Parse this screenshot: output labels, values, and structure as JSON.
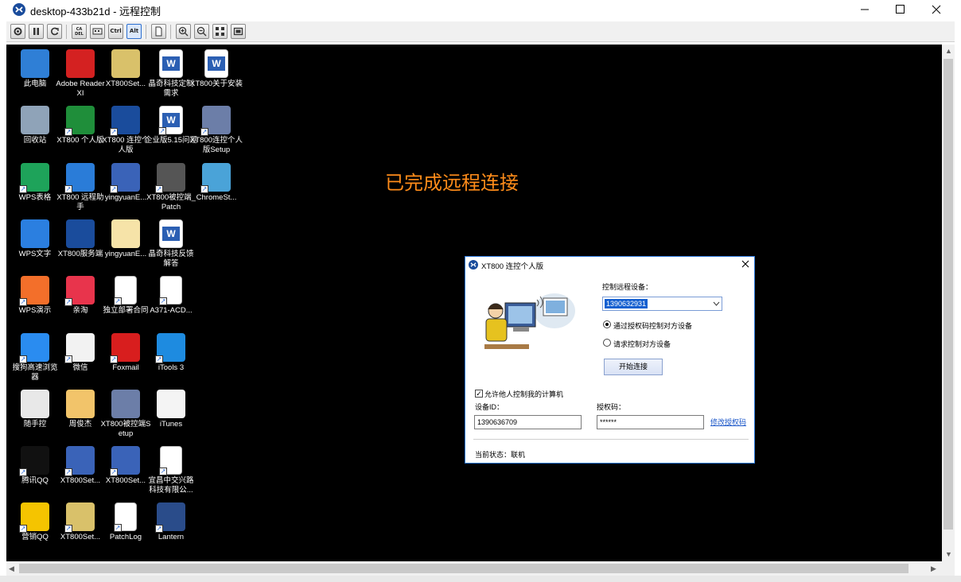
{
  "window": {
    "title": "desktop-433b21d - 远程控制",
    "app_icon": "xt800-icon",
    "controls": [
      "minimize-icon",
      "maximize-icon",
      "close-icon"
    ]
  },
  "toolbar": {
    "buttons": [
      {
        "name": "settings-icon"
      },
      {
        "name": "pause-icon"
      },
      {
        "name": "refresh-icon"
      },
      {
        "name": "ctrl-alt-del-icon",
        "text": "CA DEL"
      },
      {
        "name": "keyboard-icon"
      },
      {
        "name": "ctrl-key-icon",
        "text": "Ctrl"
      },
      {
        "name": "alt-key-icon",
        "text": "Alt"
      },
      {
        "name": "file-icon"
      },
      {
        "name": "zoom-in-icon"
      },
      {
        "name": "zoom-out-icon"
      },
      {
        "name": "fit-screen-icon"
      },
      {
        "name": "fullscreen-icon"
      }
    ]
  },
  "desktop": {
    "banner": "已完成远程连接",
    "icons": [
      {
        "label": "此电脑",
        "icon": "computer-icon",
        "color": "#2f7fd6"
      },
      {
        "label": "回收站",
        "icon": "recycle-bin-icon",
        "color": "#8fa3b8"
      },
      {
        "label": "WPS表格",
        "icon": "wps-sheet-icon",
        "color": "#1ea35a"
      },
      {
        "label": "WPS文字",
        "icon": "wps-writer-icon",
        "color": "#2b7fe0"
      },
      {
        "label": "WPS演示",
        "icon": "wps-present-icon",
        "color": "#f36f2a"
      },
      {
        "label": "搜狗高速浏览器",
        "icon": "sogou-browser-icon",
        "color": "#2a8cf0"
      },
      {
        "label": "随手控",
        "icon": "suishoukong-icon",
        "color": "#e8e8e8"
      },
      {
        "label": "腾讯QQ",
        "icon": "qq-icon",
        "color": "#111111"
      },
      {
        "label": "营销QQ",
        "icon": "marketing-qq-icon",
        "color": "#f5c400"
      },
      {
        "label": "Adobe Reader XI",
        "icon": "adobe-reader-icon",
        "color": "#d42121"
      },
      {
        "label": "XT800 个人版",
        "icon": "xt800-personal-icon",
        "color": "#1f8e3a"
      },
      {
        "label": "XT800 远程助手",
        "icon": "xt800-assistant-icon",
        "color": "#2a7cd8"
      },
      {
        "label": "XT800服务端",
        "icon": "xt800-server-icon",
        "color": "#1a4c9c"
      },
      {
        "label": "亲淘",
        "icon": "qintao-icon",
        "color": "#e8344c"
      },
      {
        "label": "微信",
        "icon": "wechat-icon",
        "color": "#f2f2f2"
      },
      {
        "label": "周俊杰",
        "icon": "folder-icon",
        "color": "#f2c46a"
      },
      {
        "label": "XT800Set...",
        "icon": "winrar-icon",
        "color": "#3a63b8"
      },
      {
        "label": "XT800Set...",
        "icon": "setup-icon",
        "color": "#d9c16a"
      },
      {
        "label": "XT800Set...",
        "icon": "setup-icon",
        "color": "#d9c16a"
      },
      {
        "label": "XT800 连控个人版",
        "icon": "xt800-control-icon",
        "color": "#1a4c9c"
      },
      {
        "label": "yingyuanE...",
        "icon": "winrar-icon",
        "color": "#3a63b8"
      },
      {
        "label": "yingyuanE...",
        "icon": "folder-icon",
        "color": "#f6e3a8"
      },
      {
        "label": "独立部署合同",
        "icon": "pdf-icon",
        "color": "#ffffff"
      },
      {
        "label": "Foxmail",
        "icon": "foxmail-icon",
        "color": "#d81e1e"
      },
      {
        "label": "XT800被控端Setup",
        "icon": "installer-icon",
        "color": "#6c7ea8"
      },
      {
        "label": "XT800Set...",
        "icon": "winrar-icon",
        "color": "#3a63b8"
      },
      {
        "label": "PatchLog",
        "icon": "text-file-icon",
        "color": "#ffffff"
      },
      {
        "label": "晶奇科技定制需求",
        "icon": "word-doc-icon",
        "color": "#2b5fb3"
      },
      {
        "label": "企业版5.15问题",
        "icon": "word-doc-icon",
        "color": "#2b5fb3"
      },
      {
        "label": "XT800被控端_Patch",
        "icon": "patch-icon",
        "color": "#555555"
      },
      {
        "label": "晶奇科技反馈解答",
        "icon": "word-doc-icon",
        "color": "#2b5fb3"
      },
      {
        "label": "A371-ACD...",
        "icon": "blank-file-icon",
        "color": "#ffffff"
      },
      {
        "label": "iTools 3",
        "icon": "itools-icon",
        "color": "#1e8be0"
      },
      {
        "label": "iTunes",
        "icon": "itunes-icon",
        "color": "#f4f4f4"
      },
      {
        "label": "宜昌中交兴路科技有限公...",
        "icon": "pdf-icon",
        "color": "#ffffff"
      },
      {
        "label": "Lantern",
        "icon": "lantern-icon",
        "color": "#2a4c8a"
      },
      {
        "label": "XT800关于安装",
        "icon": "word-doc-icon",
        "color": "#2b5fb3"
      },
      {
        "label": "XT800连控个人版Setup",
        "icon": "installer-icon",
        "color": "#6c7ea8"
      },
      {
        "label": "ChromeSt...",
        "icon": "chrome-setup-icon",
        "color": "#4aa3d8"
      }
    ]
  },
  "dialog": {
    "title": "XT800 连控个人版",
    "device_label": "控制远程设备：",
    "device_value": "1390632931",
    "radio_auth": "通过授权码控制对方设备",
    "radio_request": "请求控制对方设备",
    "radio_selected": "auth",
    "connect_button": "开始连接",
    "allow_label": "允许他人控制我的计算机",
    "allow_checked": true,
    "device_id_label": "设备ID：",
    "device_id_value": "1390636709",
    "auth_code_label": "授权码：",
    "auth_code_value": "******",
    "change_code_link": "修改授权码",
    "status_text": "当前状态：联机"
  }
}
